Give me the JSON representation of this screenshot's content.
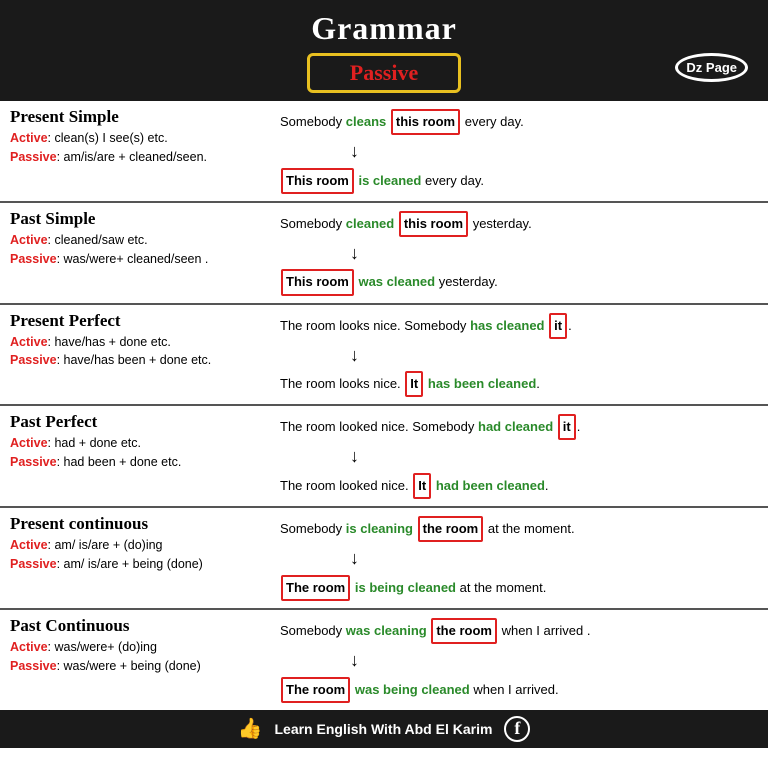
{
  "header": {
    "title": "Grammar",
    "passive": "Passive",
    "dz": "Dz Page"
  },
  "sections": [
    {
      "id": "present-simple",
      "title": "Present Simple",
      "active_label": "Active",
      "active_rule": ": clean(s) I see(s) etc.",
      "passive_label": "Passive",
      "passive_rule": ": am/is/are + cleaned/seen.",
      "example_active": "Somebody",
      "example_verb1": "cleans",
      "example_obj1": "this room",
      "example_rest1": "every day.",
      "example_subj2": "This room",
      "example_verb2": "is cleaned",
      "example_rest2": "every day."
    },
    {
      "id": "past-simple",
      "title": "Past Simple",
      "active_label": "Active",
      "active_rule": ": cleaned/saw etc.",
      "passive_label": "Passive",
      "passive_rule": ": was/were+ cleaned/seen .",
      "example_active": "Somebody",
      "example_verb1": "cleaned",
      "example_obj1": "this room",
      "example_rest1": "yesterday.",
      "example_subj2": "This room",
      "example_verb2": "was cleaned",
      "example_rest2": "yesterday."
    },
    {
      "id": "present-perfect",
      "title": "Present Perfect",
      "active_label": "Active",
      "active_rule": ": have/has + done etc.",
      "passive_label": "Passive",
      "passive_rule": ": have/has been + done etc.",
      "line1_text": "The room looks nice. Somebody",
      "line1_verb": "has cleaned",
      "line1_obj": "it",
      "line1_dot": ".",
      "line2_subj": "The room looks nice.",
      "line2_boxed": "It",
      "line2_verb": "has been cleaned",
      "line2_end": "."
    },
    {
      "id": "past-perfect",
      "title": "Past Perfect",
      "active_label": "Active",
      "active_rule": ": had + done etc.",
      "passive_label": "Passive",
      "passive_rule": ": had been + done etc.",
      "line1_text": "The room looked nice. Somebody",
      "line1_verb": "had cleaned",
      "line1_obj": "it",
      "line1_dot": ".",
      "line2_subj": "The room looked nice.",
      "line2_boxed": "It",
      "line2_verb": "had been cleaned",
      "line2_end": "."
    },
    {
      "id": "present-continuous",
      "title": "Present continuous",
      "active_label": "Active",
      "active_rule": ": am/ is/are + (do)ing",
      "passive_label": "Passive",
      "passive_rule": ": am/ is/are + being (done)",
      "example_active": "Somebody",
      "example_verb1": "is cleaning",
      "example_obj1": "the room",
      "example_rest1": "at the moment.",
      "example_subj2": "The room",
      "example_verb2": "is being cleaned",
      "example_rest2": "at the moment."
    },
    {
      "id": "past-continuous",
      "title": "Past Continuous",
      "active_label": "Active",
      "active_rule": ": was/were+ (do)ing",
      "passive_label": "Passive",
      "passive_rule": ": was/were + being (done)",
      "example_active": "Somebody",
      "example_verb1": "was cleaning",
      "example_obj1": "the room",
      "example_rest1": "when I arrived .",
      "example_subj2": "The room",
      "example_verb2": "was being cleaned",
      "example_rest2": "when I arrived."
    }
  ],
  "footer": {
    "text": "Learn English With Abd El Karim"
  }
}
